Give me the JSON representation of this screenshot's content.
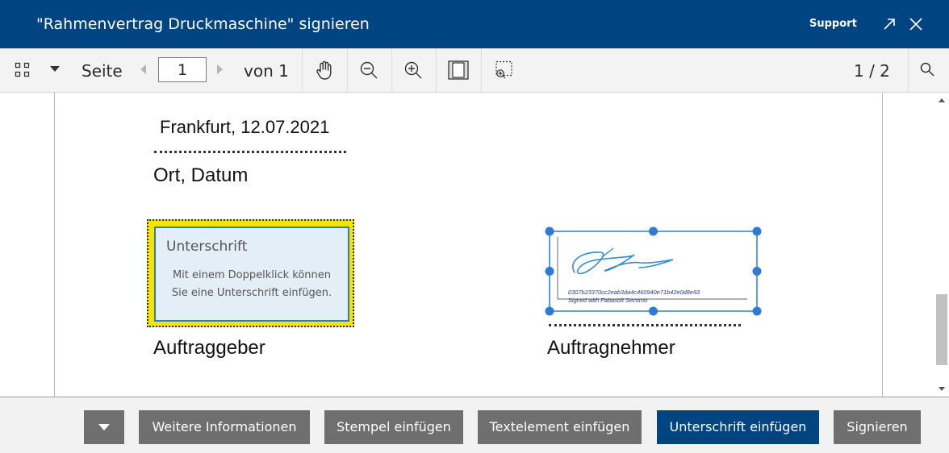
{
  "window": {
    "title": "\"Rahmenvertrag Druckmaschine\" signieren",
    "support_label": "Support",
    "external_icon": "open-external-icon",
    "close_icon": "close-icon"
  },
  "toolbar": {
    "thumbnails_icon": "grid-icon",
    "dropdown_icon": "caret-down-icon",
    "page_label": "Seite",
    "current_page": "1",
    "of_label": "von 1",
    "pan_icon": "hand-icon",
    "zoom_out_icon": "zoom-out-icon",
    "zoom_in_icon": "zoom-in-icon",
    "page_view_icon": "single-page-icon",
    "zoom_area_icon": "zoom-area-icon",
    "doc_counter": "1 / 2",
    "search_icon": "search-icon"
  },
  "document": {
    "place_date_value": "Frankfurt, 12.07.2021",
    "place_date_label": "Ort, Datum",
    "signature_field": {
      "title": "Unterschrift",
      "description_line1": "Mit einem Doppelklick können",
      "description_line2": "Sie eine Unterschrift einfügen."
    },
    "signature_image": {
      "hash": "0307b23370cc2eab3da4c460940e71b42e0d8e93",
      "signed_with": "Signed with Fabasoft Secomo"
    },
    "client_label": "Auftraggeber",
    "contractor_label": "Auftragnehmer"
  },
  "footer": {
    "more_icon": "caret-down-icon",
    "buttons": {
      "more_info": "Weitere Informationen",
      "insert_stamp": "Stempel einfügen",
      "insert_text": "Textelement einfügen",
      "insert_signature": "Unterschrift einfügen",
      "sign": "Signieren"
    }
  },
  "colors": {
    "brand": "#004481",
    "button_grey": "#6f6f6f",
    "field_highlight": "#f5e400",
    "field_fill": "#e3eef7",
    "handle_blue": "#2c7bd8",
    "ink_blue": "#2b8fd0"
  }
}
